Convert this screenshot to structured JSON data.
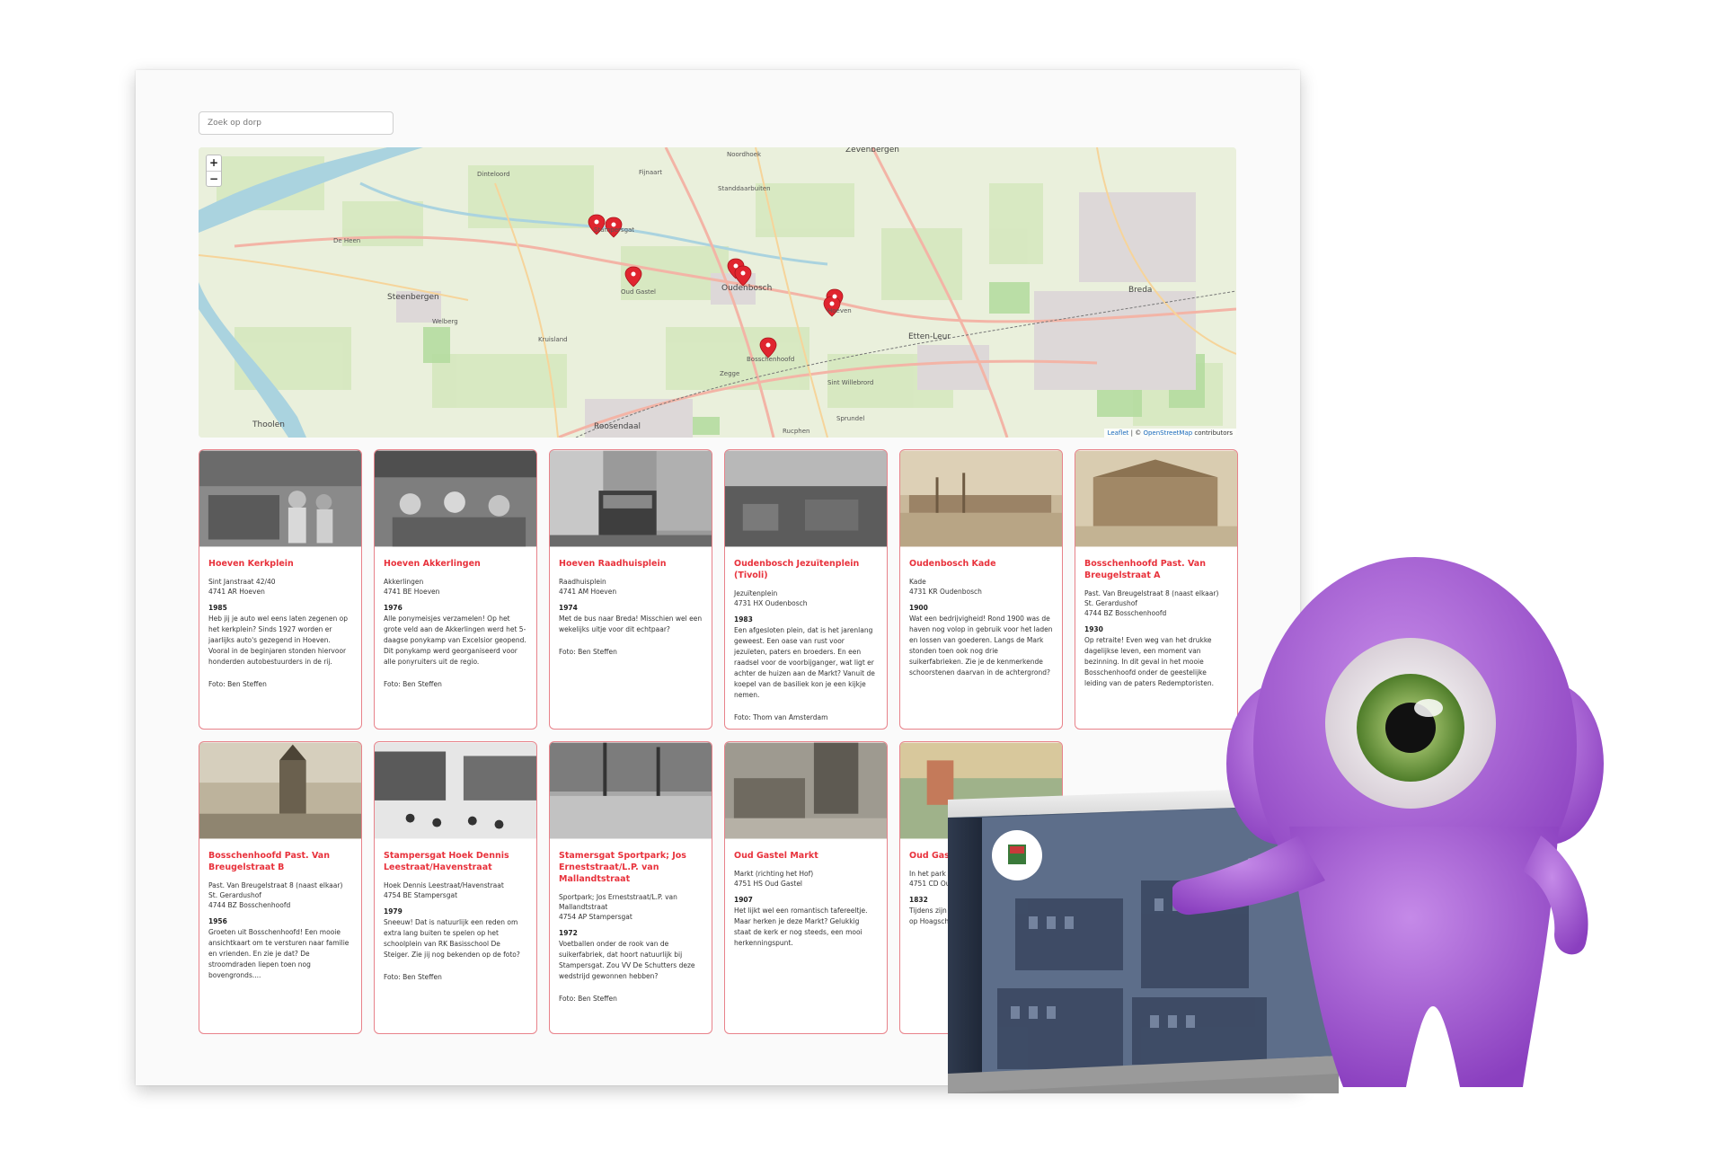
{
  "search": {
    "placeholder": "Zoek op dorp"
  },
  "map": {
    "zoom_in": "+",
    "zoom_out": "−",
    "attribution": {
      "leaflet": "Leaflet",
      "sep": " | © ",
      "osm": "OpenStreetMap",
      "suffix": " contributors"
    },
    "labels": [
      "Noordhoek",
      "Zevenbergen",
      "Stampersgat",
      "Oud Gastel",
      "Oudenbosch",
      "Hoeven",
      "Bosschenhoofd",
      "Steenbergen",
      "Etten-Leur",
      "Breda",
      "Roosendaal",
      "Thoolen",
      "Welberg",
      "Kruisland",
      "Zegge",
      "Sint Willebrord",
      "Sprundel",
      "Rucphen",
      "De Heen",
      "Dinteloord",
      "Fijnaart",
      "Standdaarbuiten"
    ]
  },
  "colors": {
    "accent": "#e8323c",
    "card_border": "#e8828a",
    "mascot": "#a85fd8"
  },
  "cards": [
    {
      "title": "Hoeven Kerkplein",
      "addr1": "Sint Janstraat 42/40",
      "addr2": "4741 AR Hoeven",
      "year": "1985",
      "desc": "Heb jij je auto wel eens laten zegenen op het kerkplein? Sinds 1927 worden er jaarlijks auto's gezegend in Hoeven. Vooral in de beginjaren stonden hiervoor honderden autobestuurders in de rij.",
      "credit": "Foto: Ben Steffen"
    },
    {
      "title": "Hoeven Akkerlingen",
      "addr1": "Akkerlingen",
      "addr2": "4741 BE Hoeven",
      "year": "1976",
      "desc": "Alle ponymeisjes verzamelen! Op het grote veld aan de Akkerlingen werd het 5-daagse ponykamp van Excelsior geopend. Dit ponykamp werd georganiseerd voor alle ponyruiters uit de regio.",
      "credit": "Foto: Ben Steffen"
    },
    {
      "title": "Hoeven Raadhuisplein",
      "addr1": "Raadhuisplein",
      "addr2": "4741 AM Hoeven",
      "year": "1974",
      "desc": "Met de bus naar Breda! Misschien wel een wekelijks uitje voor dit echtpaar?",
      "credit": "Foto: Ben Steffen"
    },
    {
      "title": "Oudenbosch Jezuïtenplein (Tivoli)",
      "addr1": "Jezuïtenplein",
      "addr2": "4731 HX Oudenbosch",
      "year": "1983",
      "desc": "Een afgesloten plein, dat is het jarenlang geweest. Een oase van rust voor jezuïeten, paters en broeders. En een raadsel voor de voorbijganger, wat ligt er achter de huizen aan de Markt? Vanuit de koepel van de basiliek kon je een kijkje nemen.",
      "credit": "Foto: Thom van Amsterdam"
    },
    {
      "title": "Oudenbosch Kade",
      "addr1": "Kade",
      "addr2": "4731 KR Oudenbosch",
      "year": "1900",
      "desc": "Wat een bedrijvigheid! Rond 1900 was de haven nog volop in gebruik voor het laden en lossen van goederen. Langs de Mark stonden toen ook nog drie suikerfabrieken. Zie je de kenmerkende schoorstenen daarvan in de achtergrond?",
      "credit": ""
    },
    {
      "title": "Bosschenhoofd Past. Van Breugelstraat A",
      "addr1": "Past. Van Breugelstraat 8 (naast elkaar) St. Gerardushof",
      "addr2": "4744 BZ Bosschenhoofd",
      "year": "1930",
      "desc": "Op retraite! Even weg van het drukke dagelijkse leven, een moment van bezinning. In dit geval in het mooie Bosschenhoofd onder de geestelijke leiding van de paters Redemptoristen.",
      "credit": ""
    },
    {
      "title": "Bosschenhoofd Past. Van Breugelstraat B",
      "addr1": "Past. Van Breugelstraat 8 (naast elkaar) St. Gerardushof",
      "addr2": "4744 BZ Bosschenhoofd",
      "year": "1956",
      "desc": "Groeten uit Bosschenhoofd! Een mooie ansichtkaart om te versturen naar familie en vrienden. En zie je dat? De stroomdraden liepen toen nog bovengronds....",
      "credit": ""
    },
    {
      "title": "Stampersgat Hoek Dennis Leestraat/Havenstraat",
      "addr1": "Hoek Dennis Leestraat/Havenstraat",
      "addr2": "4754 BE Stampersgat",
      "year": "1979",
      "desc": "Sneeuw! Dat is natuurlijk een reden om extra lang buiten te spelen op het schoolplein van RK Basisschool De Steiger. Zie jij nog bekenden op de foto?",
      "credit": "Foto: Ben Steffen"
    },
    {
      "title": "Stamersgat Sportpark; Jos Erneststraat/L.P. van Mallandtstraat",
      "addr1": "Sportpark; Jos Erneststraat/L.P. van Mallandtstraat",
      "addr2": "4754 AP Stampersgat",
      "year": "1972",
      "desc": "Voetballen onder de rook van de suikerfabriek, dat hoort natuurlijk bij Stampersgat. Zou VV De Schutters deze wedstrijd gewonnen hebben?",
      "credit": "Foto: Ben Steffen"
    },
    {
      "title": "Oud Gastel Markt",
      "addr1": "Markt (richting het Hof)",
      "addr2": "4751 HS Oud Gastel",
      "year": "1907",
      "desc": "Het lijkt wel een romantisch tafereeltje. Maar herken je deze Markt? Gelukkig staat de kerk er nog steeds, een mooi herkenningspunt.",
      "credit": ""
    },
    {
      "title": "Oud Gast Parkstra",
      "addr1": "In het park (",
      "addr2": "4751 CD Ou",
      "year": "1832",
      "desc": "Tijdens zijn gedurende tekende Da lustig op Hoagsche Gastel. Van zicht op be",
      "credit": ""
    }
  ],
  "box": {
    "year": "1983"
  }
}
